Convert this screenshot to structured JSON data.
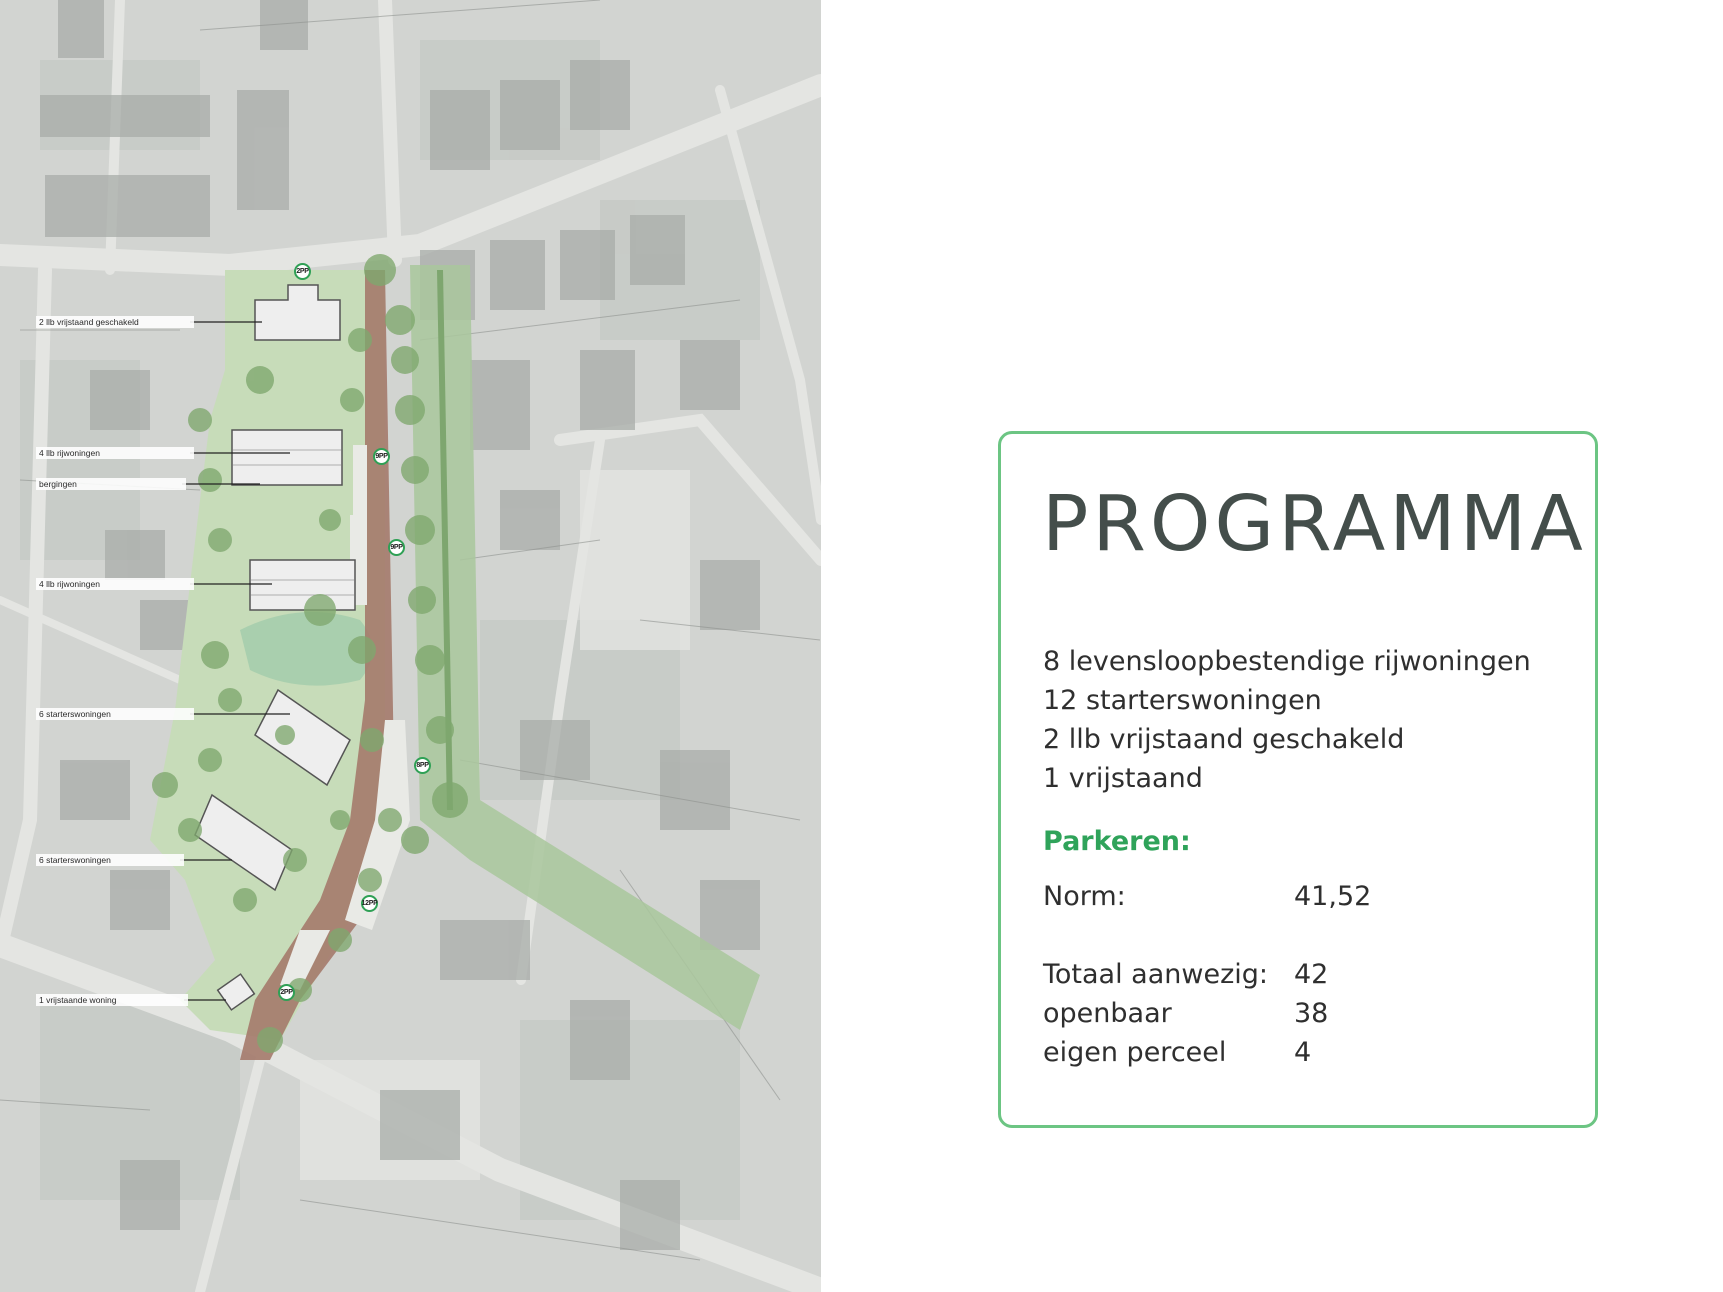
{
  "map": {
    "labels": [
      "2 llb vrijstaand geschakeld",
      "4 llb rijwoningen",
      "bergingen",
      "4 llb rijwoningen",
      "6 starterswoningen",
      "6 starterswoningen",
      "1 vrijstaande woning"
    ],
    "parking_badges": [
      "2PP",
      "9PP",
      "9PP",
      "8PP",
      "12PP",
      "2PP"
    ]
  },
  "program": {
    "title": "PROGRAMMA",
    "items": [
      "8 levensloopbestendige rijwoningen",
      "12 starterswoningen",
      "2 llb vrijstaand geschakeld",
      "1 vrijstaand"
    ],
    "parking_heading": "Parkeren:",
    "norm": {
      "label": "Norm:",
      "value": "41,52"
    },
    "totals": [
      {
        "label": "Totaal aanwezig:",
        "value": "42"
      },
      {
        "label": "openbaar",
        "value": "38"
      },
      {
        "label": "eigen perceel",
        "value": "4"
      }
    ]
  },
  "colors": {
    "accent_green": "#2fa35a",
    "card_border": "#6cc583",
    "title_gray": "#444e4b"
  }
}
